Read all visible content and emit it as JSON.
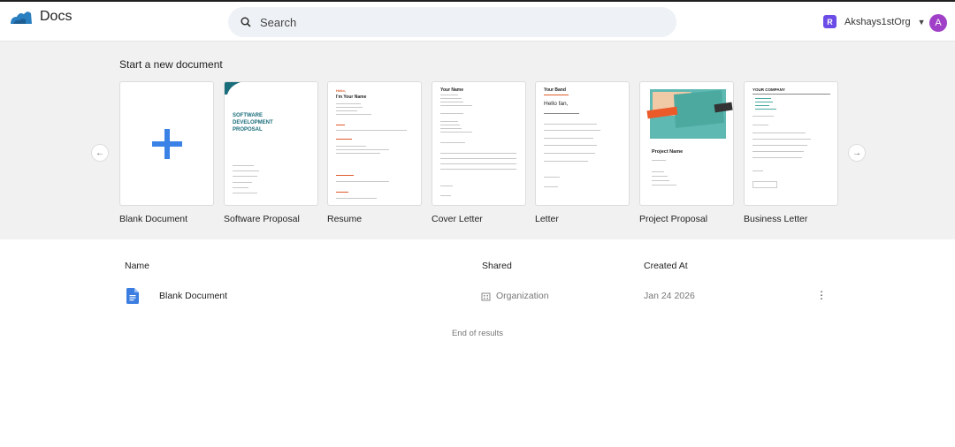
{
  "app": {
    "name": "Docs",
    "org_name": "Akshays1stOrg",
    "org_initial": "R",
    "avatar_initial": "A",
    "brand_color": "#2a7fc1",
    "org_color": "#6b4ce6",
    "avatar_color": "#a040c8"
  },
  "search": {
    "placeholder": "Search"
  },
  "templates": {
    "heading": "Start a new document",
    "items": [
      {
        "label": "Blank Document"
      },
      {
        "label": "Software Proposal",
        "preview_title": "SOFTWARE DEVELOPMENT PROPOSAL"
      },
      {
        "label": "Resume",
        "preview_hello": "Hello,",
        "preview_name": "I'm Your Name"
      },
      {
        "label": "Cover Letter",
        "preview_name": "Your Name"
      },
      {
        "label": "Letter",
        "preview_band": "Your Band",
        "preview_greeting": "Hello fan,"
      },
      {
        "label": "Project Proposal",
        "preview_title": "Project Name"
      },
      {
        "label": "Business Letter",
        "preview_company": "YOUR COMPANY"
      }
    ]
  },
  "table": {
    "columns": {
      "name": "Name",
      "shared": "Shared",
      "created": "Created At"
    },
    "rows": [
      {
        "name": "Blank Document",
        "shared": "Organization",
        "created": "Jan 24 2026"
      }
    ],
    "end_text": "End of results"
  }
}
